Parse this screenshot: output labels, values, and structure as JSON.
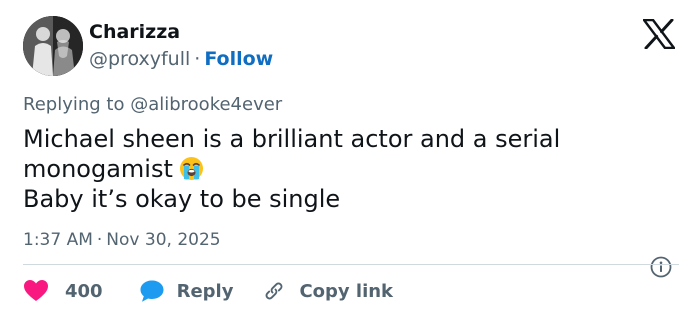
{
  "author": {
    "name": "Charizza",
    "handle": "@proxyfull",
    "separator": "·",
    "follow_label": "Follow"
  },
  "logo_icon": "x-logo-icon",
  "reply_context": {
    "text": "Replying to @alibrooke4ever"
  },
  "tweet": {
    "lines": [
      "Michael sheen is a brilliant actor and a serial",
      "monogamist",
      "Baby it’s okay to be single"
    ],
    "emoji_icon": "loudly-crying-face-emoji"
  },
  "meta": {
    "time": "1:37 AM",
    "separator": "·",
    "date": "Nov 30, 2025",
    "info_icon": "info-icon"
  },
  "actions": {
    "like_count": "400",
    "reply_label": "Reply",
    "copy_label": "Copy link"
  },
  "colors": {
    "text": "#0f1419",
    "muted": "#536471",
    "link_blue": "#0f6dc2",
    "like_pink": "#f91880",
    "reply_blue": "#1d9bf0",
    "divider": "#cfd9de"
  }
}
